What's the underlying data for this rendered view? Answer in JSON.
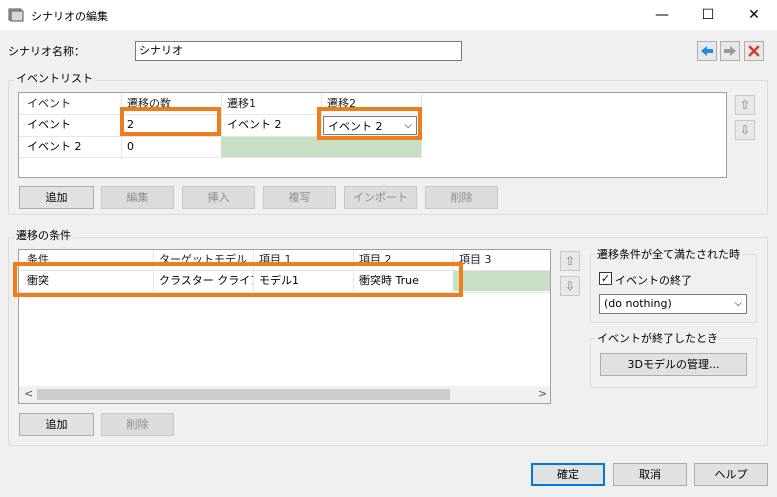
{
  "window": {
    "title": "シナリオの編集",
    "minimize": "—",
    "maximize": "☐",
    "close": "✕"
  },
  "scenario": {
    "name_label": "シナリオ名称：",
    "name_value": "シナリオ"
  },
  "nav": {
    "back_icon": "arrow-left-icon",
    "forward_icon": "arrow-right-icon",
    "delete_icon": "close-x-icon",
    "back_color": "#1f8ae0",
    "delete_color": "#d23c2c"
  },
  "event_list": {
    "label": "イベントリスト",
    "headers": [
      "イベント",
      "遷移の数",
      "遷移1",
      "遷移2"
    ],
    "rows": [
      {
        "event": "イベント",
        "count": "2",
        "t1": "イベント 2",
        "t2": "イベント 2"
      },
      {
        "event": "イベント 2",
        "count": "0",
        "t1": "",
        "t2": ""
      }
    ],
    "buttons": {
      "add": "追加",
      "edit": "編集",
      "insert": "挿入",
      "copy": "複写",
      "import": "インポート",
      "delete": "削除"
    }
  },
  "conditions": {
    "label": "遷移の条件",
    "headers": [
      "条件",
      "ターゲットモデル",
      "項目 1",
      "項目 2",
      "項目 3"
    ],
    "rows": [
      {
        "cond": "衝突",
        "target": "クラスター クライアント ...",
        "item1": "モデル1",
        "item2": "衝突時 True",
        "item3": ""
      }
    ],
    "buttons": {
      "add": "追加",
      "delete": "削除"
    }
  },
  "all_satisfied": {
    "label": "遷移条件が全て満たされた時",
    "checkbox_label": "イベントの終了",
    "checked": "✓",
    "select_value": "(do nothing)"
  },
  "event_end": {
    "label": "イベントが終了したとき",
    "button": "3Dモデルの管理..."
  },
  "footer": {
    "ok": "確定",
    "cancel": "取消",
    "help": "ヘルプ"
  },
  "arrows": {
    "up": "⇧",
    "down": "⇩",
    "scroll_left": "<",
    "scroll_right": ">"
  },
  "colors": {
    "highlight": "#f07d1c",
    "green_cell": "#c7e0c4"
  }
}
